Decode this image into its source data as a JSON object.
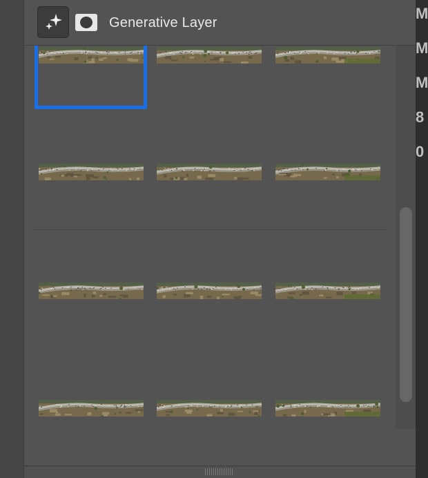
{
  "layer": {
    "title": "Generative Layer",
    "icon": "sparkles-icon",
    "mask_icon": "layer-mask-icon"
  },
  "variations": {
    "selected_index": 0,
    "groups": [
      {
        "items": [
          "variation-1",
          "variation-2",
          "variation-3",
          "variation-4",
          "variation-5",
          "variation-6"
        ]
      },
      {
        "items": [
          "variation-7",
          "variation-8",
          "variation-9",
          "variation-10",
          "variation-11",
          "variation-12"
        ]
      }
    ]
  },
  "right_panel_fragments": [
    "M",
    "M",
    "M",
    "8",
    "0"
  ],
  "colors": {
    "selection": "#1a6ee6",
    "panel": "#535353"
  }
}
